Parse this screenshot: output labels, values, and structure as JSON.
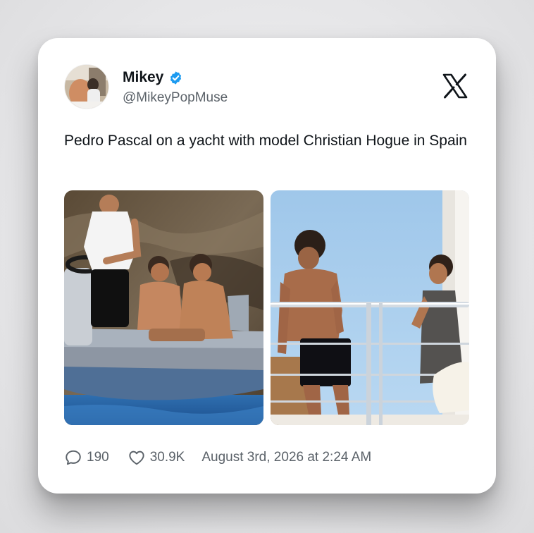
{
  "post": {
    "author": {
      "name": "Mikey",
      "handle": "@MikeyPopMuse",
      "verified": true
    },
    "text": "Pedro Pascal on a yacht with model Christian Hogue in Spain",
    "media": [
      {
        "name": "boat-photo"
      },
      {
        "name": "yacht-deck-photo"
      }
    ],
    "stats": {
      "replies": "190",
      "likes": "30.9K"
    },
    "timestamp": "August 3rd, 2026 at 2:24 AM"
  },
  "icons": {
    "verified": "verified-badge-icon",
    "brand": "x-logo-icon",
    "reply": "comment-bubble-icon",
    "like": "heart-icon"
  },
  "colors": {
    "verified": "#1d9bf0",
    "text": "#0f1419",
    "secondary": "#5b6269"
  }
}
